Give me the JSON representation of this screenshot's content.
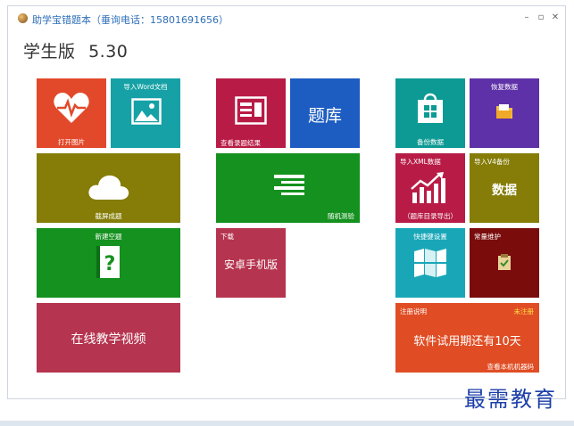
{
  "window": {
    "title": "助学宝错题本（垂询电话：15801691656）",
    "controls": {
      "minimize": "–",
      "restore": "▫",
      "close": "✕"
    }
  },
  "header": {
    "edition": "学生版",
    "version": "5.30"
  },
  "tiles": {
    "open_image": {
      "label": "打开图片",
      "color": "#e2492b"
    },
    "import_word": {
      "label": "导入Word文档",
      "color": "#16a1a6"
    },
    "view_results": {
      "label": "查看录题结果",
      "color": "#b81c46"
    },
    "question_bank": {
      "label": "题库",
      "color": "#1d5dc2"
    },
    "backup_data": {
      "label": "备份数据",
      "color": "#0d9a94"
    },
    "restore_data": {
      "label": "恢复数据",
      "color": "#5f31a8"
    },
    "screenshot": {
      "label": "截屏成题",
      "color": "#857d07"
    },
    "random_test": {
      "label": "随机测验",
      "color": "#14911e"
    },
    "import_xml": {
      "label": "导入XML数据",
      "sublabel": "（题库目录导出）",
      "color": "#b81c46"
    },
    "import_v4": {
      "label": "导入V4备份",
      "big": "数据",
      "color": "#857d07"
    },
    "new_blank": {
      "label": "新建空题",
      "color": "#14911e"
    },
    "download": {
      "label": "下载",
      "big": "安卓手机版",
      "color": "#b5344f"
    },
    "shortcuts": {
      "label": "快捷键设置",
      "color": "#19a7b8"
    },
    "maintenance": {
      "label": "常量维护",
      "color": "#7a0c0c"
    },
    "online_video": {
      "big": "在线教学视频",
      "color": "#b5344f"
    },
    "registration": {
      "label": "注册说明",
      "status": "未注册",
      "big": "软件试用期还有10天",
      "footer": "查看本机机器码",
      "color": "#e04d24"
    }
  },
  "watermark": "最需教育"
}
